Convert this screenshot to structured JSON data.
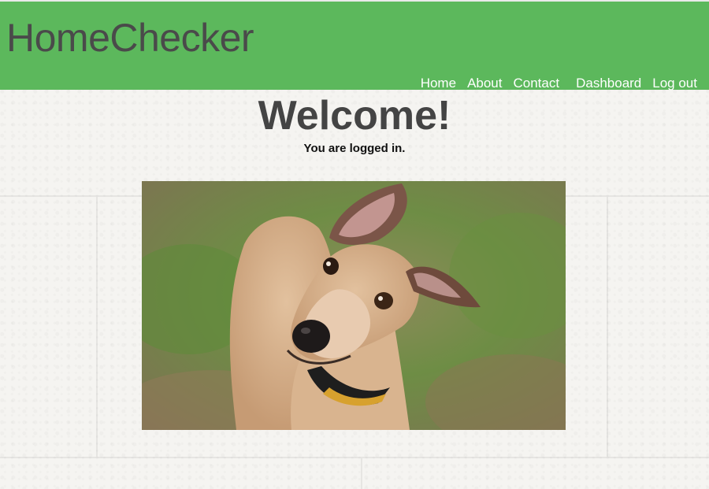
{
  "header": {
    "brand": "HomeChecker",
    "nav": [
      "Home",
      "About",
      "Contact",
      "Dashboard",
      "Log out"
    ]
  },
  "main": {
    "title": "Welcome!",
    "subtitle": "You are logged in."
  },
  "colors": {
    "header_bg": "#5cb85c",
    "brand_text": "#4a4a4a",
    "nav_text": "#ffffff",
    "title_text": "#444444"
  },
  "image": {
    "subject": "greyhound dog photo"
  }
}
